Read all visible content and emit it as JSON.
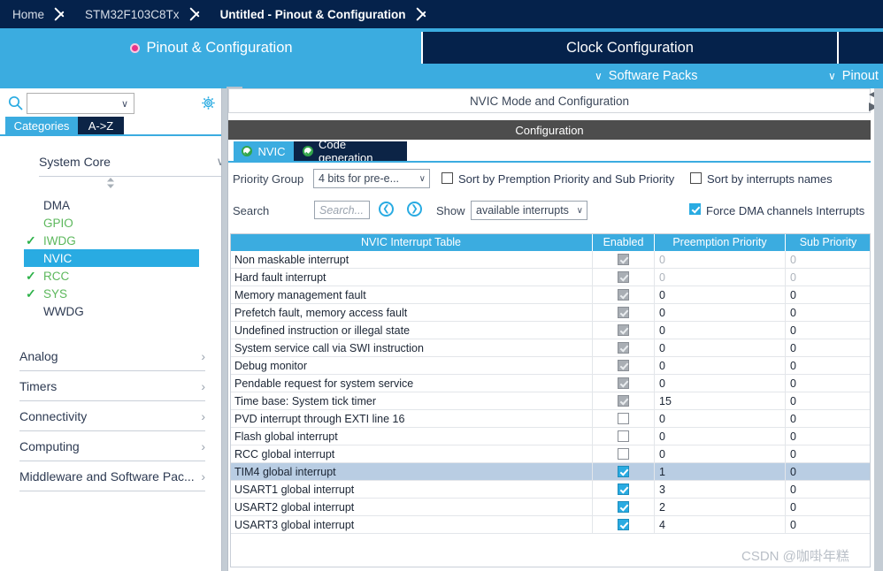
{
  "breadcrumb": {
    "items": [
      {
        "label": "Home",
        "active": false
      },
      {
        "label": "STM32F103C8Tx",
        "active": false
      },
      {
        "label": "Untitled - Pinout & Configuration",
        "active": true
      }
    ]
  },
  "main_tabs": {
    "pinout": "Pinout & Configuration",
    "clock": "Clock Configuration",
    "extra": ""
  },
  "tab_subrow": {
    "software_packs": "Software Packs",
    "pinout_view": "Pinout",
    "chevron": "∨"
  },
  "sidebar": {
    "search_placeholder": "",
    "search_value": "",
    "tabs": {
      "categories": "Categories",
      "a_to_z": "A->Z"
    },
    "group_header": "System Core",
    "peripherals": [
      {
        "label": "DMA",
        "state": "plain",
        "checked": false
      },
      {
        "label": "GPIO",
        "state": "green",
        "checked": false
      },
      {
        "label": "IWDG",
        "state": "green",
        "checked": true
      },
      {
        "label": "NVIC",
        "state": "selected",
        "checked": false
      },
      {
        "label": "RCC",
        "state": "green",
        "checked": true
      },
      {
        "label": "SYS",
        "state": "green",
        "checked": true
      },
      {
        "label": "WWDG",
        "state": "plain",
        "checked": false
      }
    ],
    "categories": [
      {
        "label": "Analog"
      },
      {
        "label": "Timers"
      },
      {
        "label": "Connectivity"
      },
      {
        "label": "Computing"
      },
      {
        "label": "Middleware and Software Pac..."
      }
    ],
    "arrow_right": "›",
    "arrow_down": "∨"
  },
  "main": {
    "mode_title": "NVIC Mode and Configuration",
    "config_title": "Configuration",
    "tabs": [
      {
        "label": "NVIC",
        "selected": true
      },
      {
        "label": "Code generation",
        "selected": false
      }
    ],
    "priority_group_label": "Priority Group",
    "priority_group_value": "4 bits for pre-e...",
    "sort_preemption_label": "Sort by Premption Priority and Sub Priority",
    "sort_preemption_checked": false,
    "sort_names_label": "Sort by interrupts names",
    "sort_names_checked": false,
    "search_label": "Search",
    "search_placeholder": "Search...",
    "search_value": "",
    "show_label": "Show",
    "show_value": "available interrupts",
    "force_dma_label": "Force DMA channels Interrupts",
    "force_dma_checked": true,
    "nav_prev": "❮",
    "nav_next": "❯"
  },
  "table": {
    "headers": [
      "NVIC Interrupt Table",
      "Enabled",
      "Preemption Priority",
      "Sub Priority"
    ],
    "rows": [
      {
        "name": "Non maskable interrupt",
        "enabled": "locked",
        "preemption": "0",
        "sub": "0",
        "dim": true,
        "selected": false
      },
      {
        "name": "Hard fault interrupt",
        "enabled": "locked",
        "preemption": "0",
        "sub": "0",
        "dim": true,
        "selected": false
      },
      {
        "name": "Memory management fault",
        "enabled": "locked",
        "preemption": "0",
        "sub": "0",
        "dim": false,
        "selected": false
      },
      {
        "name": "Prefetch fault, memory access fault",
        "enabled": "locked",
        "preemption": "0",
        "sub": "0",
        "dim": false,
        "selected": false
      },
      {
        "name": "Undefined instruction or illegal state",
        "enabled": "locked",
        "preemption": "0",
        "sub": "0",
        "dim": false,
        "selected": false
      },
      {
        "name": "System service call via SWI instruction",
        "enabled": "locked",
        "preemption": "0",
        "sub": "0",
        "dim": false,
        "selected": false
      },
      {
        "name": "Debug monitor",
        "enabled": "locked",
        "preemption": "0",
        "sub": "0",
        "dim": false,
        "selected": false
      },
      {
        "name": "Pendable request for system service",
        "enabled": "locked",
        "preemption": "0",
        "sub": "0",
        "dim": false,
        "selected": false
      },
      {
        "name": "Time base: System tick timer",
        "enabled": "locked",
        "preemption": "15",
        "sub": "0",
        "dim": false,
        "selected": false
      },
      {
        "name": "PVD interrupt through EXTI line 16",
        "enabled": "off",
        "preemption": "0",
        "sub": "0",
        "dim": false,
        "selected": false
      },
      {
        "name": "Flash global interrupt",
        "enabled": "off",
        "preemption": "0",
        "sub": "0",
        "dim": false,
        "selected": false
      },
      {
        "name": "RCC global interrupt",
        "enabled": "off",
        "preemption": "0",
        "sub": "0",
        "dim": false,
        "selected": false
      },
      {
        "name": "TIM4 global interrupt",
        "enabled": "on",
        "preemption": "1",
        "sub": "0",
        "dim": false,
        "selected": true
      },
      {
        "name": "USART1 global interrupt",
        "enabled": "on",
        "preemption": "3",
        "sub": "0",
        "dim": false,
        "selected": false
      },
      {
        "name": "USART2 global interrupt",
        "enabled": "on",
        "preemption": "2",
        "sub": "0",
        "dim": false,
        "selected": false
      },
      {
        "name": "USART3 global interrupt",
        "enabled": "on",
        "preemption": "4",
        "sub": "0",
        "dim": false,
        "selected": false
      }
    ]
  },
  "watermark": "CSDN @咖啩年糕",
  "colors": {
    "brand_dark": "#05224b",
    "brand_blue": "#3bace0",
    "accent_pink": "#e8338a",
    "ok_green": "#31a54a",
    "row_selected": "#b9cde3"
  }
}
